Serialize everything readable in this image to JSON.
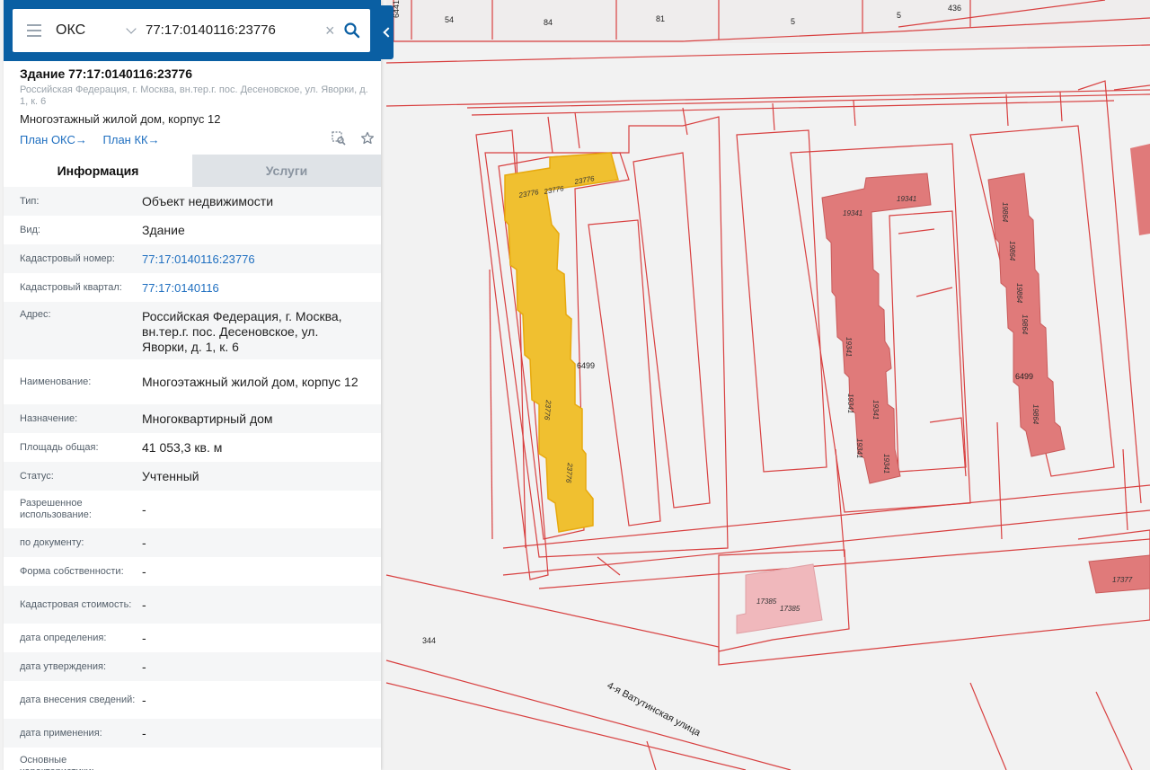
{
  "search": {
    "type_label": "ОКС",
    "query": "77:17:0140116:23776",
    "clear_glyph": "×"
  },
  "object": {
    "title": "Здание 77:17:0140116:23776",
    "address_short": "Российская Федерация, г. Москва, вн.тер.г. пос. Десеновское, ул. Яворки, д. 1, к. 6",
    "name": "Многоэтажный жилой дом, корпус 12",
    "link_oks": "План ОКС",
    "link_kk": "План КК",
    "arrow": "→"
  },
  "tabs": {
    "info": "Информация",
    "services": "Услуги"
  },
  "rows": [
    {
      "label": "Тип:",
      "value": "Объект недвижимости"
    },
    {
      "label": "Вид:",
      "value": "Здание"
    },
    {
      "label": "Кадастровый номер:",
      "value": "77:17:0140116:23776"
    },
    {
      "label": "Кадастровый квартал:",
      "value": "77:17:0140116"
    },
    {
      "label": "Адрес:",
      "value": "Российская Федерация, г. Москва, вн.тер.г. пос. Десеновское, ул. Яворки, д. 1, к. 6"
    },
    {
      "label": "Наименование:",
      "value": "Многоэтажный жилой дом, корпус 12"
    },
    {
      "label": "Назначение:",
      "value": "Многоквартирный дом"
    },
    {
      "label": "Площадь общая:",
      "value": "41 053,3 кв. м"
    },
    {
      "label": "Статус:",
      "value": "Учтенный"
    },
    {
      "label": "Разрешенное использование:",
      "value": "-"
    },
    {
      "label": "по документу:",
      "value": "-"
    },
    {
      "label": "Форма собственности:",
      "value": "-"
    },
    {
      "label": "Кадастровая стоимость:",
      "value": "-"
    },
    {
      "label": "дата определения:",
      "value": "-"
    },
    {
      "label": "дата утверждения:",
      "value": "-"
    },
    {
      "label": "дата внесения сведений:",
      "value": "-"
    },
    {
      "label": "дата применения:",
      "value": "-"
    },
    {
      "label": "Основные характеристики:",
      "value": ""
    }
  ],
  "map": {
    "parcel_labels": [
      "6441",
      "54",
      "84",
      "81",
      "5",
      "5",
      "436",
      "344",
      "6499",
      "6499"
    ],
    "building_labels": [
      "23776",
      "23776",
      "23776",
      "23776",
      "23776",
      "19341",
      "19341",
      "19341",
      "19341",
      "19341",
      "19341",
      "19341",
      "19864",
      "19864",
      "19864",
      "19864",
      "19864",
      "17385",
      "17385",
      "17377"
    ],
    "street": "4-я Ватутинская улица",
    "colors": {
      "selected": "#f0c030",
      "building": "#e07a7a",
      "line": "#d84040",
      "light_building": "#f0b8bc"
    }
  }
}
